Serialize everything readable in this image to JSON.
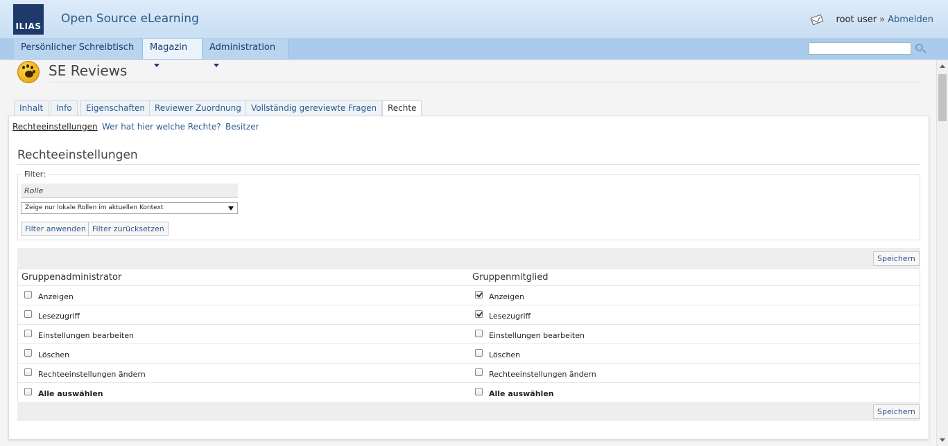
{
  "header": {
    "logo_text": "ILIAS",
    "site_title": "Open Source eLearning",
    "user_name": "root user",
    "user_sep": "»",
    "logout_label": "Abmelden"
  },
  "mainmenu": [
    {
      "label": "Persönlicher Schreibtisch"
    },
    {
      "label": "Magazin"
    },
    {
      "label": "Administration"
    }
  ],
  "search": {
    "placeholder": ""
  },
  "page": {
    "title": "SE Reviews"
  },
  "tabs": [
    {
      "label": "Inhalt"
    },
    {
      "label": "Info"
    },
    {
      "label": "Eigenschaften"
    },
    {
      "label": "Reviewer Zuordnung"
    },
    {
      "label": "Vollständig gereviewte Fragen"
    },
    {
      "label": "Rechte"
    }
  ],
  "subtabs": [
    {
      "label": "Rechteeinstellungen"
    },
    {
      "label": "Wer hat hier welche Rechte?"
    },
    {
      "label": "Besitzer"
    }
  ],
  "section_title": "Rechteeinstellungen",
  "filter": {
    "legend": "Filter:",
    "role_label": "Rolle",
    "role_value": "Zeige nur lokale Rollen im aktuellen Kontext",
    "apply_label": "Filter anwenden",
    "reset_label": "Filter zurücksetzen"
  },
  "permissions": {
    "save_label": "Speichern",
    "columns": [
      {
        "role": "Gruppenadministrator",
        "rows": [
          {
            "label": "Anzeigen",
            "checked": false
          },
          {
            "label": "Lesezugriff",
            "checked": false
          },
          {
            "label": "Einstellungen bearbeiten",
            "checked": false
          },
          {
            "label": "Löschen",
            "checked": false
          },
          {
            "label": "Rechteeinstellungen ändern",
            "checked": false
          },
          {
            "label": "Alle auswählen",
            "checked": false
          }
        ]
      },
      {
        "role": "Gruppenmitglied",
        "rows": [
          {
            "label": "Anzeigen",
            "checked": true
          },
          {
            "label": "Lesezugriff",
            "checked": true
          },
          {
            "label": "Einstellungen bearbeiten",
            "checked": false
          },
          {
            "label": "Löschen",
            "checked": false
          },
          {
            "label": "Rechteeinstellungen ändern",
            "checked": false
          },
          {
            "label": "Alle auswählen",
            "checked": false
          }
        ]
      }
    ]
  }
}
